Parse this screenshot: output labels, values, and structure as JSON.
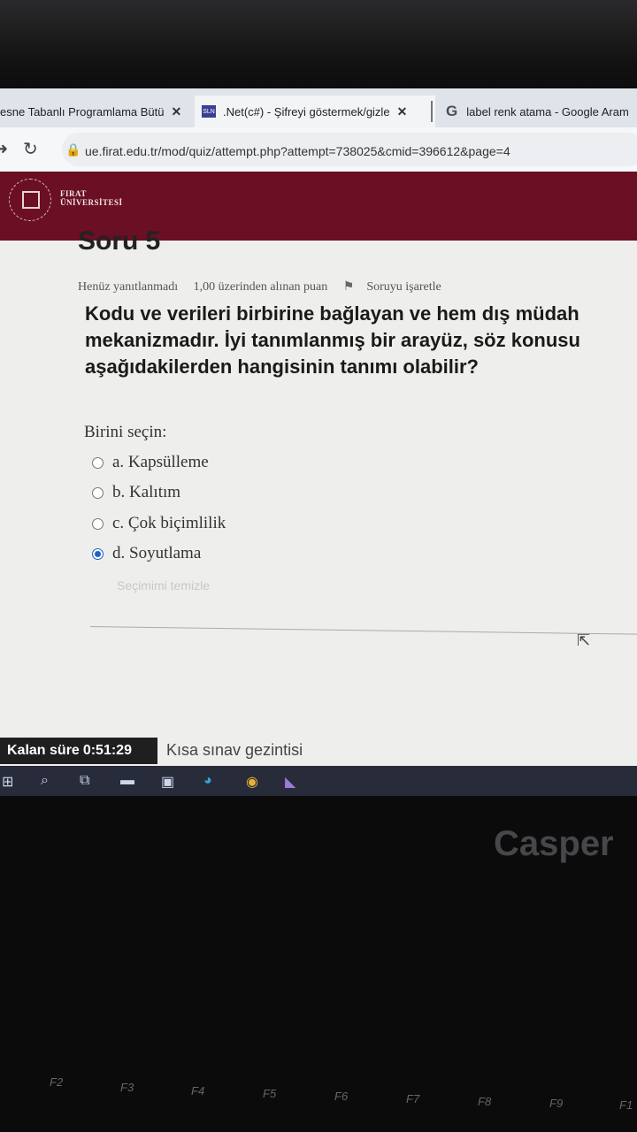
{
  "browser": {
    "tabs": [
      {
        "title": "esne Tabanlı Programlama Bütü"
      },
      {
        "favicon": "SLN",
        "title": ".Net(c#) - Şifreyi göstermek/gizle"
      },
      {
        "favicon": "G",
        "title": "label renk atama - Google Aram"
      }
    ],
    "url": "ue.firat.edu.tr/mod/quiz/attempt.php?attempt=738025&cmid=396612&page=4"
  },
  "site": {
    "logo_line1": "FIRAT",
    "logo_line2": "ÜNİVERSİTESİ"
  },
  "question": {
    "title": "Soru 5",
    "status": "Henüz yanıtlanmadı",
    "points": "1,00 üzerinden alınan puan",
    "flag_label": "Soruyu işaretle",
    "text_lines": [
      "Kodu ve verileri birbirine bağlayan ve hem dış müdah",
      "mekanizmadır. İyi tanımlanmış bir arayüz, söz konusu",
      "aşağıdakilerden hangisinin tanımı olabilir?"
    ],
    "prompt": "Birini seçin:",
    "options": [
      {
        "label": "a. Kapsülleme",
        "selected": false
      },
      {
        "label": "b. Kalıtım",
        "selected": false
      },
      {
        "label": "c. Çok biçimlilik",
        "selected": false
      },
      {
        "label": "d. Soyutlama",
        "selected": true
      }
    ],
    "clear_label": "Seçimimi temizle"
  },
  "footer": {
    "timer_label": "Kalan süre",
    "timer_value": "0:51:29",
    "nav_label": "Kısa sınav gezintisi"
  },
  "laptop": {
    "brand": "Casper",
    "fkeys": [
      "F2",
      "F3",
      "F4",
      "F5",
      "F6",
      "F7",
      "F8",
      "F9",
      "F1"
    ]
  },
  "colors": {
    "header": "#6a0f24",
    "radio_selected": "#1e5fc8",
    "taskbar": "#272b3a"
  }
}
